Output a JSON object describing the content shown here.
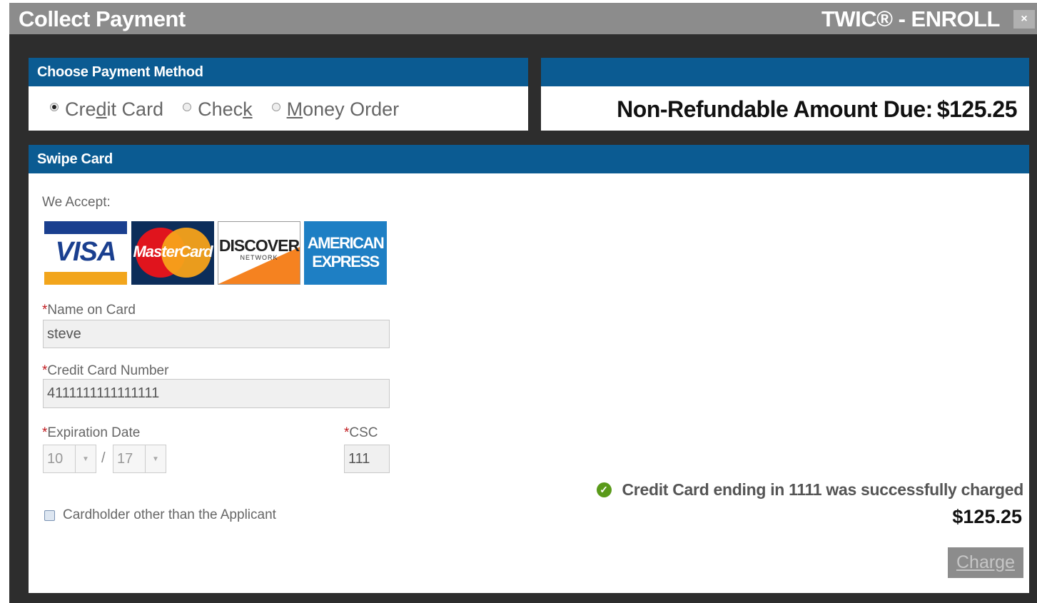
{
  "window": {
    "title": "Collect Payment",
    "app_name": "TWIC® - ENROLL",
    "close_label": "×"
  },
  "payment_method": {
    "header": "Choose Payment Method",
    "options": [
      {
        "label_pre": "Cre",
        "label_ul": "d",
        "label_post": "it Card",
        "selected": true
      },
      {
        "label_pre": "Chec",
        "label_ul": "k",
        "label_post": "",
        "selected": false
      },
      {
        "label_pre": "",
        "label_ul": "M",
        "label_post": "oney Order",
        "selected": false
      }
    ]
  },
  "amount": {
    "label": "Non-Refundable Amount Due:",
    "value": "$125.25"
  },
  "swipe": {
    "header": "Swipe Card",
    "accept_label": "We Accept:",
    "cards": {
      "visa": "VISA",
      "mastercard": "MasterCard",
      "discover": "DISCOVER",
      "discover_sub": "NETWORK",
      "amex_line1": "AMERICAN",
      "amex_line2": "EXPRESS"
    },
    "required_mark": "*",
    "name_label": "Name on Card",
    "name_value": "steve",
    "number_label": "Credit Card Number",
    "number_value": "4111111111111111",
    "expiration_label": "Expiration Date",
    "exp_month": "10",
    "exp_year": "17",
    "exp_separator": "/",
    "csc_label": "CSC",
    "csc_value": "111",
    "cardholder_label": "Cardholder other than the Applicant",
    "cardholder_checked": false
  },
  "result": {
    "message": "Credit Card ending in 1111 was successfully charged",
    "amount": "$125.25"
  },
  "charge_button": {
    "label": "Charge"
  },
  "icons": {
    "success": "check-circle-icon",
    "dropdown": "chevron-down-icon",
    "close": "close-icon"
  },
  "colors": {
    "title_bar": "#8c8c8c",
    "panel_header": "#0b5b92",
    "backdrop": "#2d2d2d",
    "required": "#c0171c",
    "success": "#5a9a1a"
  }
}
